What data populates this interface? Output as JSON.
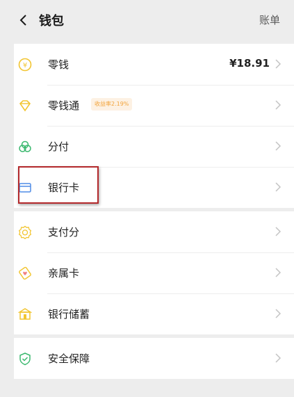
{
  "header": {
    "title": "钱包",
    "bill_label": "账单"
  },
  "colors": {
    "accent": "#f2c531",
    "green": "#3ab86e",
    "blue": "#4e8be6",
    "highlight": "#b3282b"
  },
  "group1": [
    {
      "label": "零钱",
      "value": "¥18.91",
      "icon": "coin-icon"
    },
    {
      "label": "零钱通",
      "badge": "收益率2.19%",
      "icon": "diamond-icon"
    },
    {
      "label": "分付",
      "icon": "clover-icon"
    },
    {
      "label": "银行卡",
      "icon": "card-icon"
    }
  ],
  "group2": [
    {
      "label": "支付分",
      "icon": "badge-icon"
    },
    {
      "label": "亲属卡",
      "icon": "heart-card-icon"
    },
    {
      "label": "银行储蓄",
      "icon": "bank-icon"
    }
  ],
  "group3": [
    {
      "label": "安全保障",
      "icon": "shield-icon"
    }
  ]
}
